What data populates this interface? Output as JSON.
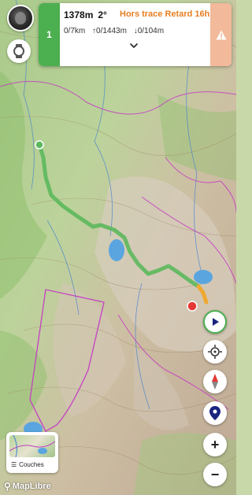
{
  "panel": {
    "stage_number": "1",
    "altitude": "1378m",
    "temperature": "2°",
    "status": "Hors trace Retard 16h",
    "distance": "0/7km",
    "ascent": "↑0/1443m",
    "descent": "↓0/104m"
  },
  "layers": {
    "label": "Couches"
  },
  "attribution": {
    "text": "MapLibre"
  },
  "colors": {
    "track_done": "#5cb85c",
    "track_orange": "#f0a830",
    "stage_green": "#4caf50",
    "status_orange": "#e67e22",
    "warn_bg": "#f2b99a",
    "position_red": "#e53935",
    "nav_blue": "#1a237e"
  },
  "icons": {
    "watch": "watch-icon",
    "warning": "warning-icon",
    "expand": "chevron-down-icon",
    "play": "play-icon",
    "locate": "crosshair-icon",
    "compass": "compass-icon",
    "marker": "map-marker-icon",
    "zoom_in": "plus-icon",
    "zoom_out": "minus-icon",
    "layers": "layers-icon",
    "maplibre": "maplibre-logo-icon"
  },
  "zoom": {
    "in_label": "+",
    "out_label": "−"
  }
}
